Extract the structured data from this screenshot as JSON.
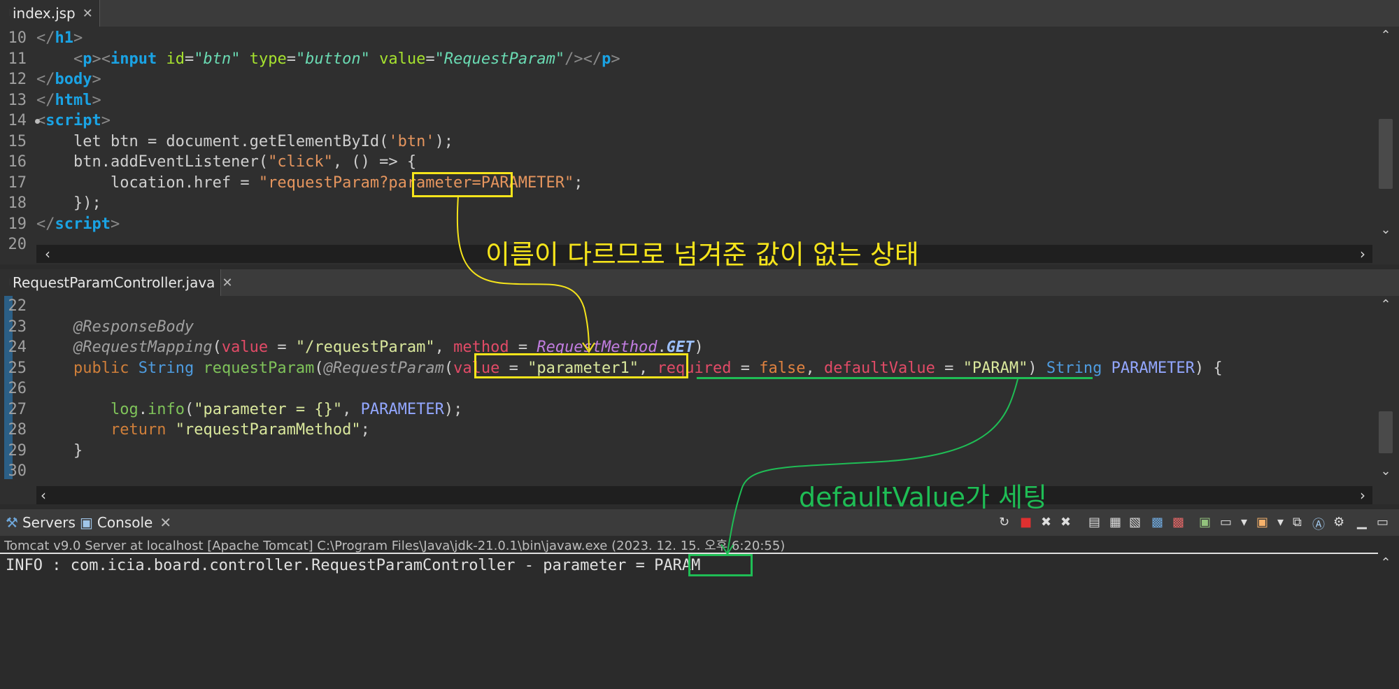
{
  "top_editor": {
    "tab_label": "index.jsp",
    "lines": [
      {
        "num": "10",
        "segs": [
          {
            "c": "br",
            "t": "</"
          },
          {
            "c": "tag",
            "t": "h1"
          },
          {
            "c": "br",
            "t": ">"
          }
        ]
      },
      {
        "num": "11",
        "segs": [
          {
            "c": "t",
            "t": "    "
          },
          {
            "c": "br",
            "t": "<"
          },
          {
            "c": "tag",
            "t": "p"
          },
          {
            "c": "br",
            "t": "><"
          },
          {
            "c": "tag",
            "t": "input"
          },
          {
            "c": "t",
            "t": " "
          },
          {
            "c": "attr",
            "t": "id"
          },
          {
            "c": "t",
            "t": "="
          },
          {
            "c": "val",
            "t": "\"btn\""
          },
          {
            "c": "t",
            "t": " "
          },
          {
            "c": "attr",
            "t": "type"
          },
          {
            "c": "t",
            "t": "="
          },
          {
            "c": "val",
            "t": "\"button\""
          },
          {
            "c": "t",
            "t": " "
          },
          {
            "c": "attr",
            "t": "value"
          },
          {
            "c": "t",
            "t": "="
          },
          {
            "c": "val",
            "t": "\"RequestParam\""
          },
          {
            "c": "br",
            "t": "/></"
          },
          {
            "c": "tag",
            "t": "p"
          },
          {
            "c": "br",
            "t": ">"
          }
        ]
      },
      {
        "num": "12",
        "segs": [
          {
            "c": "br",
            "t": "</"
          },
          {
            "c": "tag",
            "t": "body"
          },
          {
            "c": "br",
            "t": ">"
          }
        ]
      },
      {
        "num": "13",
        "segs": [
          {
            "c": "br",
            "t": "</"
          },
          {
            "c": "tag",
            "t": "html"
          },
          {
            "c": "br",
            "t": ">"
          }
        ]
      },
      {
        "num": "14",
        "fold": true,
        "segs": [
          {
            "c": "br",
            "t": "<"
          },
          {
            "c": "tag",
            "t": "script"
          },
          {
            "c": "br",
            "t": ">"
          }
        ]
      },
      {
        "num": "15",
        "segs": [
          {
            "c": "t",
            "t": "    let btn = document.getElementById("
          },
          {
            "c": "str",
            "t": "'btn'"
          },
          {
            "c": "t",
            "t": ");"
          }
        ]
      },
      {
        "num": "16",
        "segs": [
          {
            "c": "t",
            "t": "    btn.addEventListener("
          },
          {
            "c": "str",
            "t": "\"click\""
          },
          {
            "c": "t",
            "t": ", () => {"
          }
        ]
      },
      {
        "num": "17",
        "segs": [
          {
            "c": "t",
            "t": "        location.href = "
          },
          {
            "c": "str",
            "t": "\"requestParam?parameter=PARAMETER\""
          },
          {
            "c": "t",
            "t": ";"
          }
        ]
      },
      {
        "num": "18",
        "segs": [
          {
            "c": "t",
            "t": "    });"
          }
        ]
      },
      {
        "num": "19",
        "segs": [
          {
            "c": "br",
            "t": "</"
          },
          {
            "c": "tag",
            "t": "script"
          },
          {
            "c": "br",
            "t": ">"
          }
        ]
      },
      {
        "num": "20",
        "segs": []
      }
    ]
  },
  "bottom_editor": {
    "tab_label": "RequestParamController.java",
    "lines": [
      {
        "num": "22",
        "segs": []
      },
      {
        "num": "23",
        "segs": [
          {
            "c": "t",
            "t": "    "
          },
          {
            "c": "ann",
            "t": "@ResponseBody"
          }
        ]
      },
      {
        "num": "24",
        "segs": [
          {
            "c": "t",
            "t": "    "
          },
          {
            "c": "ann",
            "t": "@RequestMapping"
          },
          {
            "c": "t",
            "t": "("
          },
          {
            "c": "prm",
            "t": "value"
          },
          {
            "c": "t",
            "t": " = "
          },
          {
            "c": "jstr",
            "t": "\"/requestParam\""
          },
          {
            "c": "t",
            "t": ", "
          },
          {
            "c": "prm",
            "t": "method"
          },
          {
            "c": "t",
            "t": " = "
          },
          {
            "c": "enm",
            "t": "RequestMethod"
          },
          {
            "c": "t",
            "t": "."
          },
          {
            "c": "cst",
            "t": "GET"
          },
          {
            "c": "t",
            "t": ")"
          }
        ]
      },
      {
        "num": "25",
        "segs": [
          {
            "c": "t",
            "t": "    "
          },
          {
            "c": "kw",
            "t": "public"
          },
          {
            "c": "t",
            "t": " "
          },
          {
            "c": "ty",
            "t": "String"
          },
          {
            "c": "t",
            "t": " "
          },
          {
            "c": "fn",
            "t": "requestParam"
          },
          {
            "c": "t",
            "t": "("
          },
          {
            "c": "ann",
            "t": "@RequestParam"
          },
          {
            "c": "t",
            "t": "("
          },
          {
            "c": "prm",
            "t": "value"
          },
          {
            "c": "t",
            "t": " = "
          },
          {
            "c": "jstr",
            "t": "\"parameter1\""
          },
          {
            "c": "t",
            "t": ", "
          },
          {
            "c": "prm",
            "t": "required"
          },
          {
            "c": "t",
            "t": " = "
          },
          {
            "c": "bool",
            "t": "false"
          },
          {
            "c": "t",
            "t": ", "
          },
          {
            "c": "prm",
            "t": "defaultValue"
          },
          {
            "c": "t",
            "t": " = "
          },
          {
            "c": "jstr",
            "t": "\"PARAM\""
          },
          {
            "c": "t",
            "t": ") "
          },
          {
            "c": "ty",
            "t": "String"
          },
          {
            "c": "t",
            "t": " "
          },
          {
            "c": "fv",
            "t": "PARAMETER"
          },
          {
            "c": "t",
            "t": ") {"
          }
        ]
      },
      {
        "num": "26",
        "segs": []
      },
      {
        "num": "27",
        "segs": [
          {
            "c": "t",
            "t": "        "
          },
          {
            "c": "logc",
            "t": "log"
          },
          {
            "c": "t",
            "t": "."
          },
          {
            "c": "logc",
            "t": "info"
          },
          {
            "c": "t",
            "t": "("
          },
          {
            "c": "jstr",
            "t": "\"parameter = {}\""
          },
          {
            "c": "t",
            "t": ", "
          },
          {
            "c": "fv",
            "t": "PARAMETER"
          },
          {
            "c": "t",
            "t": ");"
          }
        ]
      },
      {
        "num": "28",
        "segs": [
          {
            "c": "t",
            "t": "        "
          },
          {
            "c": "kw",
            "t": "return"
          },
          {
            "c": "t",
            "t": " "
          },
          {
            "c": "jstr",
            "t": "\"requestParamMethod\""
          },
          {
            "c": "t",
            "t": ";"
          }
        ]
      },
      {
        "num": "29",
        "segs": [
          {
            "c": "t",
            "t": "    }"
          }
        ]
      },
      {
        "num": "30",
        "segs": []
      }
    ]
  },
  "annotations": {
    "yellow_note": "이름이 다르므로 넘겨준 값이 없는 상태",
    "green_note": "defaultValue가 세팅"
  },
  "console": {
    "servers_tab": "Servers",
    "console_tab": "Console",
    "info_line": "Tomcat v9.0 Server at localhost [Apache Tomcat] C:\\Program Files\\Java\\jdk-21.0.1\\bin\\javaw.exe  (2023. 12. 15. 오후 6:20:55)",
    "output_prefix": "INFO : com.icia.board.controller.RequestParamController - parameter = ",
    "output_value": "PARAM"
  },
  "colors": {
    "yellow": "#f5e41b",
    "green": "#1fbd55"
  }
}
